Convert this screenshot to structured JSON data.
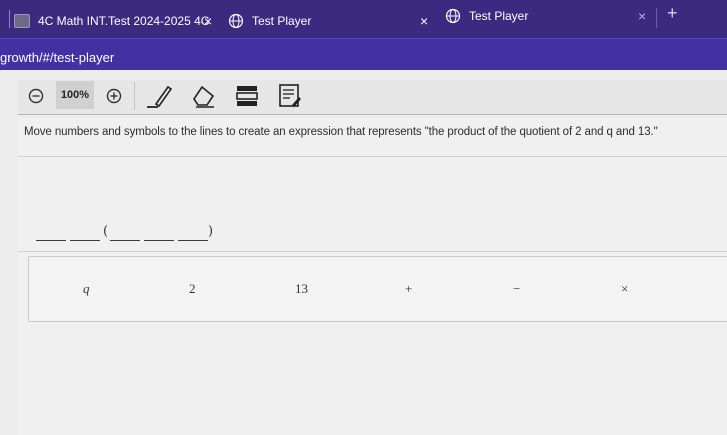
{
  "browser": {
    "tabs": [
      {
        "title": "4C Math INT.Test 2024-2025 4C",
        "close": "×"
      },
      {
        "title": "Test Player",
        "close": "×"
      },
      {
        "title": "Test Player",
        "close": "×"
      }
    ],
    "new_tab": "+",
    "url": "growth/#/test-player"
  },
  "toolbar": {
    "zoom_level": "100%"
  },
  "question": {
    "prompt": "Move numbers and symbols to the lines to create an expression that represents \"the product of the quotient of 2 and q and 13.\"",
    "open_paren": "(",
    "close_paren": ")"
  },
  "tokens": [
    "q",
    "2",
    "13",
    "+",
    "−",
    "×"
  ],
  "colors": {
    "tab_bar": "#3a2a80",
    "url_bar": "#4330a3",
    "content_bg": "#ececec"
  }
}
